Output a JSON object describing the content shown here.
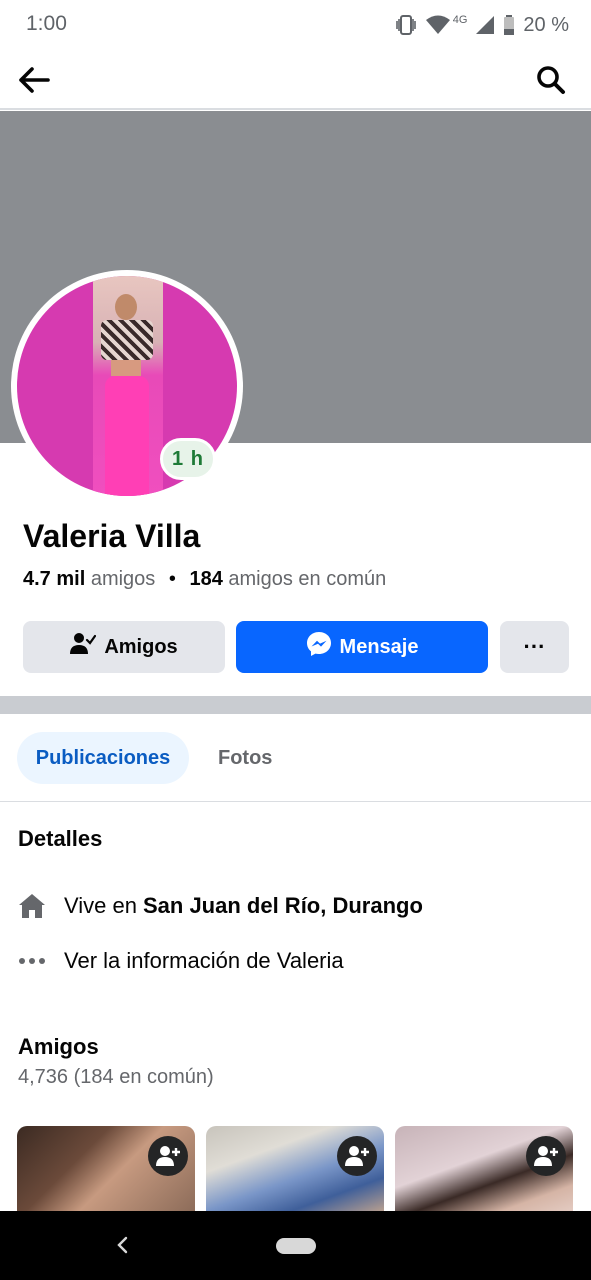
{
  "status_bar": {
    "time": "1:00",
    "network": "4G",
    "battery": "20 %",
    "icons": [
      "vibrate-icon",
      "wifi-icon",
      "signal-icon",
      "battery-icon"
    ]
  },
  "app_bar": {
    "icons": [
      "back-arrow-icon",
      "search-icon"
    ]
  },
  "profile": {
    "name": "Valeria Villa",
    "active_badge": "1 h",
    "friends_count": "4.7 mil",
    "friends_label": "amigos",
    "separator": "•",
    "mutual_count": "184",
    "mutual_label": "amigos en común"
  },
  "actions": {
    "friends_label": "Amigos",
    "message_label": "Mensaje",
    "more_label": "···"
  },
  "tabs": [
    {
      "label": "Publicaciones",
      "active": true
    },
    {
      "label": "Fotos",
      "active": false
    }
  ],
  "details": {
    "title": "Detalles",
    "lives_prefix": "Vive en",
    "lives_place": "San Juan del Río, Durango",
    "more_info": "Ver la información de Valeria"
  },
  "friends": {
    "title": "Amigos",
    "count": "4,736 (184 en común)"
  },
  "colors": {
    "accent": "#0866ff",
    "tab_active_bg": "#ebf5ff",
    "tab_active_text": "#0a5cc2",
    "cover": "#8a8d91",
    "badge_bg": "#e7f3e9",
    "badge_text": "#1e7a37"
  }
}
